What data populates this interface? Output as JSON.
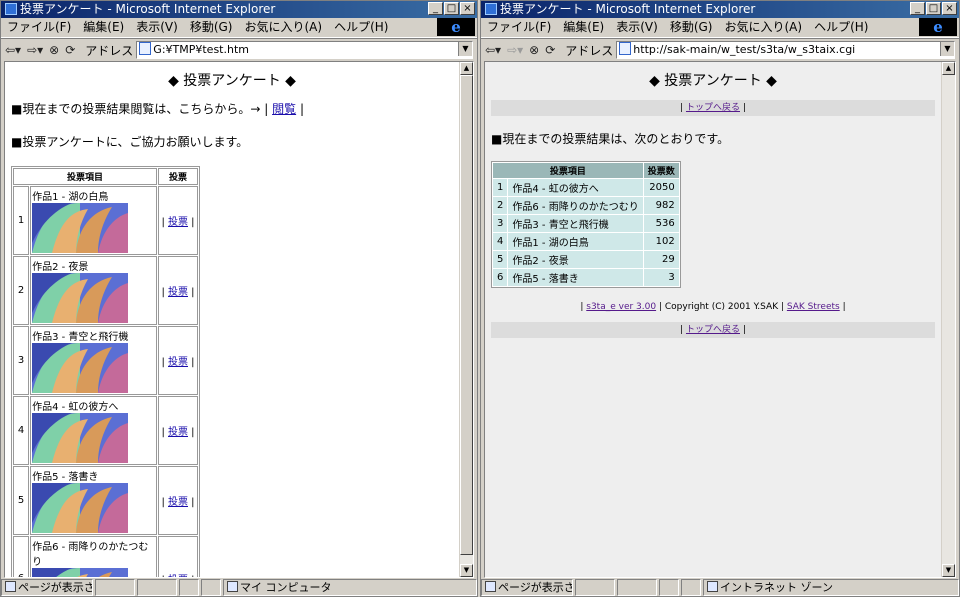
{
  "left": {
    "title": "投票アンケート - Microsoft Internet Explorer",
    "menu": [
      "ファイル(F)",
      "編集(E)",
      "表示(V)",
      "移動(G)",
      "お気に入り(A)",
      "ヘルプ(H)"
    ],
    "address_label": "アドレス",
    "address": "G:¥TMP¥test.htm",
    "page_title": "◆ 投票アンケート ◆",
    "results_line": "■現在までの投票結果閲覧は、こちらから。→ |",
    "results_link": "閲覧",
    "results_tail": "|",
    "request_line": "■投票アンケートに、ご協力お願いします。",
    "col_item": "投票項目",
    "col_vote": "投票",
    "vote_link": "投票",
    "rows": [
      {
        "no": "1",
        "name": "作品1 - 湖の白鳥"
      },
      {
        "no": "2",
        "name": "作品2 - 夜景"
      },
      {
        "no": "3",
        "name": "作品3 - 青空と飛行機"
      },
      {
        "no": "4",
        "name": "作品4 - 虹の彼方へ"
      },
      {
        "no": "5",
        "name": "作品5 - 落書き"
      },
      {
        "no": "6",
        "name": "作品6 - 雨降りのかたつむり"
      }
    ],
    "status_text": "ページが表示さ",
    "status_zone": "マイ コンピュータ"
  },
  "right": {
    "title": "投票アンケート - Microsoft Internet Explorer",
    "menu": [
      "ファイル(F)",
      "編集(E)",
      "表示(V)",
      "移動(G)",
      "お気に入り(A)",
      "ヘルプ(H)"
    ],
    "address_label": "アドレス",
    "address": "http://sak-main/w_test/s3ta/w_s3taix.cgi",
    "page_title": "◆ 投票アンケート ◆",
    "nav_link": "トップへ戻る",
    "results_intro": "■現在までの投票結果は、次のとおりです。",
    "col_item": "投票項目",
    "col_count": "投票数",
    "results": [
      {
        "rank": "1",
        "name": "作品4 - 虹の彼方へ",
        "count": "2050"
      },
      {
        "rank": "2",
        "name": "作品6 - 雨降りのかたつむり",
        "count": "982"
      },
      {
        "rank": "3",
        "name": "作品3 - 青空と飛行機",
        "count": "536"
      },
      {
        "rank": "4",
        "name": "作品1 - 湖の白鳥",
        "count": "102"
      },
      {
        "rank": "5",
        "name": "作品2 - 夜景",
        "count": "29"
      },
      {
        "rank": "6",
        "name": "作品5 - 落書き",
        "count": "3"
      }
    ],
    "footer_link1": "s3ta_e ver 3.00",
    "footer_text": "| Copyright (C) 2001 Y.SAK |",
    "footer_link2": "SAK Streets",
    "status_text": "ページが表示さ",
    "status_zone": "イントラネット ゾーン"
  }
}
